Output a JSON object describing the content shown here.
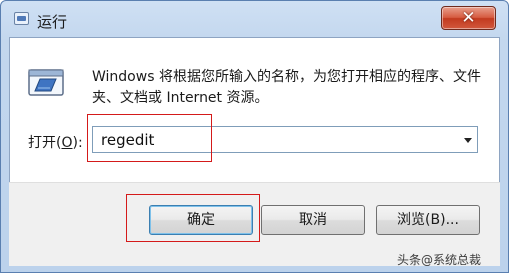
{
  "window": {
    "title": "运行",
    "close_glyph": "✕"
  },
  "dialog": {
    "description": "Windows 将根据您所输入的名称，为您打开相应的程序、文件夹、文档或 Internet 资源。",
    "open_label_prefix": "打开(",
    "open_label_key": "O",
    "open_label_suffix": "):",
    "open_value": "regedit"
  },
  "buttons": {
    "ok": "确定",
    "cancel": "取消",
    "browse": "浏览(B)..."
  },
  "watermark": "头条@系统总裁",
  "colors": {
    "highlight": "#d41a1a",
    "close_button": "#c23a1f",
    "titlebar": "#c3d7ee"
  },
  "icons": [
    "run-window-icon",
    "run-program-icon",
    "close-icon",
    "dropdown-arrow-icon"
  ]
}
